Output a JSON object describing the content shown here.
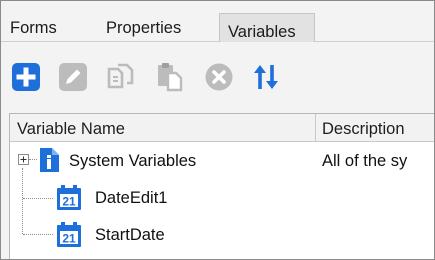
{
  "tabs": [
    {
      "label": "Forms",
      "active": false
    },
    {
      "label": "Properties",
      "active": false
    },
    {
      "label": "Variables",
      "active": true
    }
  ],
  "toolbar": {
    "icons": [
      "add-icon",
      "edit-icon",
      "copy-icon",
      "paste-icon",
      "delete-icon",
      "sort-icon"
    ],
    "accent": "#1e6fd9",
    "disabled_color": "#bcbcbc"
  },
  "grid": {
    "columns": [
      "Variable Name",
      "Description"
    ],
    "rows": [
      {
        "name": "System Variables",
        "description": "All of the sy",
        "icon": "info-document-icon",
        "expandable": true
      },
      {
        "name": "DateEdit1",
        "description": "",
        "icon": "calendar-icon",
        "expandable": false
      },
      {
        "name": "StartDate",
        "description": "",
        "icon": "calendar-icon",
        "expandable": false
      }
    ]
  },
  "calendar_icon_day": "21"
}
